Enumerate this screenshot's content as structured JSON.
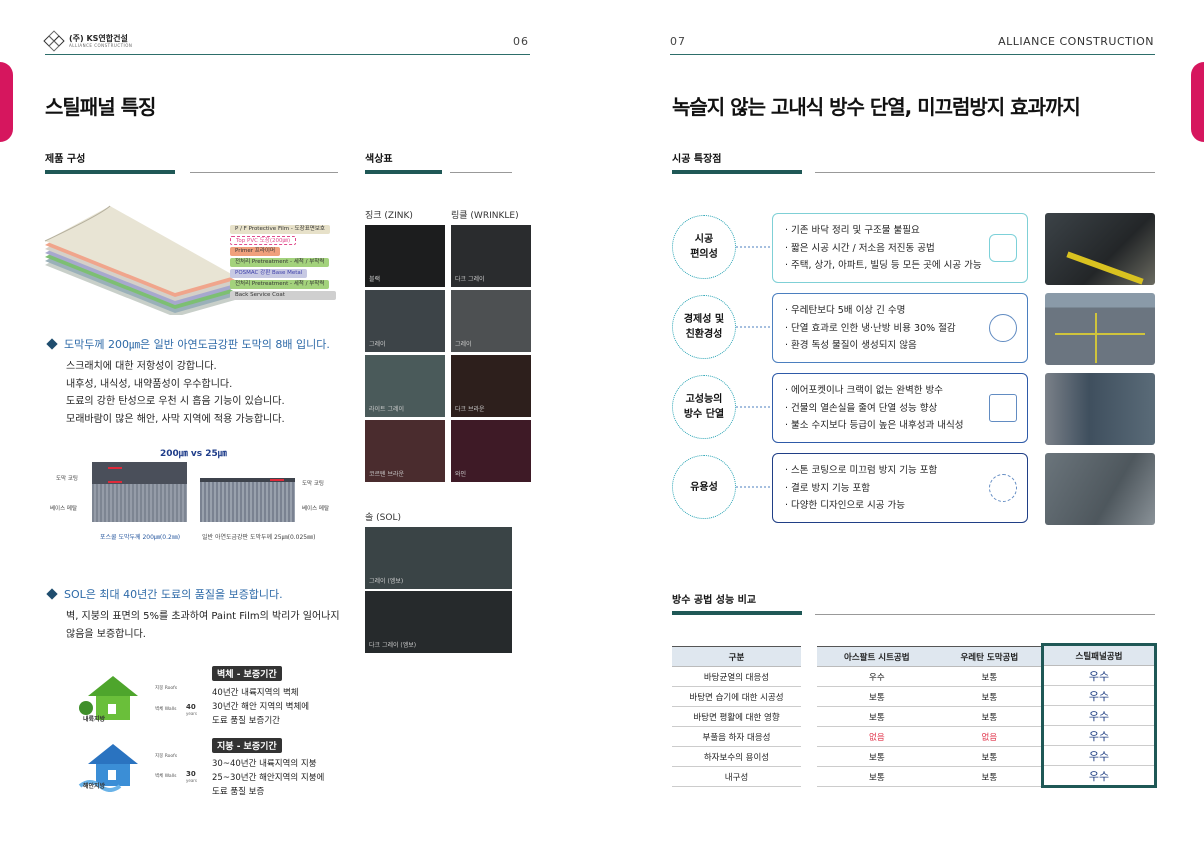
{
  "header": {
    "logo_name": "(주) KS연합건설",
    "logo_sub": "ALLIANCE CONSTRUCTION",
    "page_left": "06",
    "page_right": "07",
    "brand": "ALLIANCE CONSTRUCTION"
  },
  "left": {
    "title": "스틸패널 특징",
    "product_section": "제품 구성",
    "layers": [
      "P / F Protective Film - 도장표면보호",
      "Top PVC 도장(200㎛)",
      "Primer 프라이머",
      "전처리 Pretreatment - 세척 / 부착력",
      "POSMAC 강판 Base Metal",
      "전처리 Pretreatment - 세척 / 부착력",
      "Back Service Coat"
    ],
    "bullet1": "도막두께 200㎛은 일반 아연도금강판 도막의 8배 입니다.",
    "para1": [
      "스크래치에 대한 저항성이 강합니다.",
      "내후성, 내식성, 내약품성이 우수합니다.",
      "도료의 강한 탄성으로 우천 시 흡음 기능이 있습니다.",
      "모래바람이 많은 해안, 사막 지역에 적용 가능합니다."
    ],
    "compare": {
      "title": "200㎛ vs 25㎛",
      "left_coat": "도막 코팅",
      "left_base": "베이스 메탈",
      "right_coat": "도막 코팅",
      "right_base": "베이스 메탈",
      "left_caption": "포스쿨 도막두께 200㎛(0.2㎜)",
      "right_caption": "일반 아연도금강판 도막두께 25㎛(0.025㎜)"
    },
    "bullet2": "SOL은 최대 40년간 도료의 품질을 보증합니다.",
    "para2": [
      "벽, 지붕의 표면의 5%를 초과하여 Paint Film의 박리가 일어나지",
      "않음을 보증합니다."
    ],
    "warranty": {
      "wall_title": "벽체 - 보증기간",
      "wall_lines": [
        "40년간 내륙지역의 벽체",
        "30년간 해안 지역의 벽체에",
        "도료 품질 보증기간"
      ],
      "roof_title": "지붕 - 보증기간",
      "roof_lines": [
        "30~40년간 내륙지역의 지붕",
        "25~30년간 해안지역의 지붕에",
        "도료 품질 보증"
      ],
      "inland_label": "내륙지방",
      "coast_label": "해안지방",
      "roof_small": "지붕 Roofs",
      "wall_small": "벽체 Walls",
      "years40": "40",
      "years30": "30",
      "years_unit": "years"
    },
    "color_section": "색상표",
    "zink_label": "징크 (ZINK)",
    "wrinkle_label": "링클 (WRINKLE)",
    "sol_label": "솔 (SOL)",
    "swatches": [
      {
        "name": "블랙",
        "color": "#1c1d1e"
      },
      {
        "name": "다크 그레이",
        "color": "#2a2c2e"
      },
      {
        "name": "그레이",
        "color": "#3d4448"
      },
      {
        "name": "그레이",
        "color": "#4d5052"
      },
      {
        "name": "라이트 그레이",
        "color": "#4a5a5a"
      },
      {
        "name": "다크 브라운",
        "color": "#2d1f1c"
      },
      {
        "name": "코르텐 브라운",
        "color": "#4a2c2e"
      },
      {
        "name": "와인",
        "color": "#3e1a26"
      }
    ],
    "sol_swatches": [
      {
        "name": "그레이 (엠보)",
        "color": "#3a4446"
      },
      {
        "name": "다크 그레이 (엠보)",
        "color": "#262a2c"
      }
    ]
  },
  "right": {
    "title": "녹슬지 않는 고내식 방수 단열, 미끄럼방지 효과까지",
    "feature_section": "시공 특장점",
    "features": [
      {
        "name": "시공\n편의성",
        "lines": [
          "· 기존 바닥 정리 및 구조물 불필요",
          "· 짧은 시공 시간 / 저소음 저진동 공법",
          "· 주택, 상가, 아파트, 빌딩 등 모든 곳에 시공 가능"
        ],
        "border": "#7fd0d6"
      },
      {
        "name": "경제성 및\n친환경성",
        "lines": [
          "· 우레탄보다 5배 이상 긴 수명",
          "· 단열 효과로 인한 냉·난방 비용 30% 절감",
          "· 환경 독성 물질이 생성되지 않음"
        ],
        "border": "#4b7fbf"
      },
      {
        "name": "고성능의\n방수 단열",
        "lines": [
          "· 에어포켓이나 크랙이 없는 완벽한 방수",
          "· 건물의 열손실을 줄여 단열 성능 향상",
          "· 불소 수지보다 등급이 높은 내후성과 내식성"
        ],
        "border": "#2e5aa8"
      },
      {
        "name": "유용성",
        "lines": [
          "· 스톤 코팅으로 미끄럼 방지 기능 포함",
          "· 결로 방지 기능 포함",
          "· 다양한 디자인으로 시공 가능"
        ],
        "border": "#203f86"
      }
    ],
    "compare_section": "방수 공법 성능 비교",
    "table": {
      "head": [
        "구분",
        "아스팔트 시트공법",
        "우레탄 도막공법",
        "스틸패널공법"
      ],
      "rows": [
        [
          "바탕균열의 대응성",
          "우수",
          "보통",
          "우수"
        ],
        [
          "바탕면 습기에 대한 시공성",
          "보통",
          "보통",
          "우수"
        ],
        [
          "바탕면 평활에 대한 영향",
          "보통",
          "보통",
          "우수"
        ],
        [
          "부풀음 하자 대응성",
          "없음",
          "없음",
          "우수"
        ],
        [
          "하자보수의 용이성",
          "보통",
          "보통",
          "우수"
        ],
        [
          "내구성",
          "보통",
          "보통",
          "우수"
        ]
      ]
    }
  }
}
